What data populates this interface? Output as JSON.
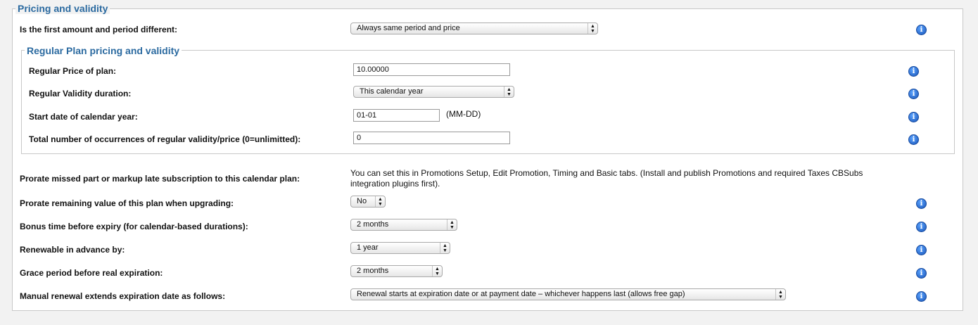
{
  "outer_legend": "Pricing and validity",
  "inner_legend": "Regular Plan pricing and validity",
  "first_amount": {
    "label": "Is the first amount and period different:",
    "value": "Always same period and price"
  },
  "regular": {
    "price_label": "Regular Price of plan:",
    "price_value": "10.00000",
    "duration_label": "Regular Validity duration:",
    "duration_value": "This calendar year",
    "start_label": "Start date of calendar year:",
    "start_value": "01-01",
    "start_hint": "(MM-DD)",
    "occurrences_label": "Total number of occurrences of regular validity/price (0=unlimitted):",
    "occurrences_value": "0"
  },
  "prorate_missed": {
    "label": "Prorate missed part or markup late subscription to this calendar plan:",
    "text": "You can set this in Promotions Setup, Edit Promotion, Timing and Basic tabs. (Install and publish Promotions and required Taxes CBSubs integration plugins first)."
  },
  "prorate_remaining": {
    "label": "Prorate remaining value of this plan when upgrading:",
    "value": "No"
  },
  "bonus_time": {
    "label": "Bonus time before expiry (for calendar-based durations):",
    "value": "2 months"
  },
  "renewable": {
    "label": "Renewable in advance by:",
    "value": "1 year"
  },
  "grace": {
    "label": "Grace period before real expiration:",
    "value": "2 months"
  },
  "manual_renewal": {
    "label": "Manual renewal extends expiration date as follows:",
    "value": "Renewal starts at expiration date or at payment date – whichever happens last (allows free gap)"
  },
  "icons": {
    "info": "info-icon",
    "select_arrow": "up-down-arrow-icon"
  },
  "colors": {
    "legend": "#2b6aa0",
    "info_icon": "#1a56b8"
  }
}
